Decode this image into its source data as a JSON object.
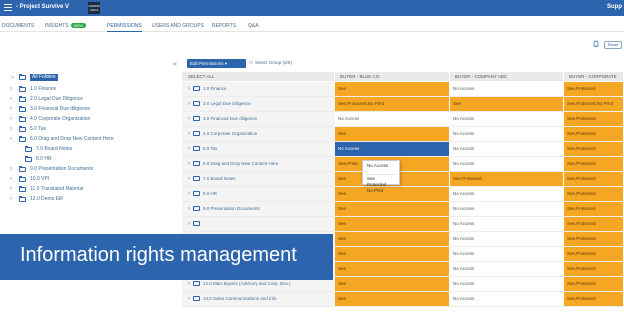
{
  "topbar": {
    "project": "- Project Survive V",
    "logo_line1": "HARRIS",
    "logo_line2": "LINKS",
    "right_label": "Supp"
  },
  "tabs": [
    {
      "label": "DOCUMENTS"
    },
    {
      "label": "INSIGHTS",
      "badge": "NEW"
    },
    {
      "label": "PERMISSIONS"
    },
    {
      "label": "USERS AND GROUPS"
    },
    {
      "label": "REPORTS"
    },
    {
      "label": "Q&A"
    }
  ],
  "actions": {
    "reset_label": "Reset",
    "collapse_glyph": "«"
  },
  "toolbar": {
    "edit_permissions": "Edit Permissions ▾",
    "select_group": "Select Group (2/5)"
  },
  "tree": [
    {
      "label": "All Folders"
    },
    {
      "label": "1.0 Finance"
    },
    {
      "label": "2.0 Legal Due Diligence"
    },
    {
      "label": "3.0 Financial Due diligence"
    },
    {
      "label": "4.0 Corporate Organization"
    },
    {
      "label": "5.0 Tax"
    },
    {
      "label": "6.0 Drag and Drop New Content Here"
    },
    {
      "label": "7.0 Board Notes"
    },
    {
      "label": "8.0 HR"
    },
    {
      "label": "9.0 Presentation Documents"
    },
    {
      "label": "10.0 VPI"
    },
    {
      "label": "11.0 Translated Material"
    },
    {
      "label": "12.0 Demo Elif"
    }
  ],
  "grid": {
    "headers": {
      "select_all": "SELECT ALL",
      "col1": "BUYER - BLUE CO.",
      "col2": "BUYER - COMPANY ABC",
      "col3": "BUYER - CORPORATE"
    },
    "rows": [
      {
        "name": "1.0 Finance",
        "c1": "See",
        "c2": "No Access",
        "c3": "See,Protected"
      },
      {
        "name": "2.0 Legal Due Diligence",
        "c1": "See,Protected,No Print",
        "c2": "See",
        "c3": "See,Protected,No Print"
      },
      {
        "name": "3.0 Financial Due diligence",
        "c1": "No Access",
        "c2": "No Access",
        "c3": "See,Protected"
      },
      {
        "name": "4.0 Corporate Organization",
        "c1": "See",
        "c2": "No Access",
        "c3": "See,Protected"
      },
      {
        "name": "5.0 Tax",
        "c1": "No Access",
        "c2": "No Access",
        "c3": "See,Protected"
      },
      {
        "name": "6.0 Drag and Drop New Content Here",
        "c1": "See,Prote",
        "c2": "No Access",
        "c3": "See,Protected"
      },
      {
        "name": "7.0 Board Notes",
        "c1": "See",
        "c2": "See,Protected",
        "c3": "See,Protected"
      },
      {
        "name": "8.0 HR",
        "c1": "See",
        "c2": "No Access",
        "c3": "See,Protected"
      },
      {
        "name": "9.0 Presentation Documents",
        "c1": "See",
        "c2": "No Access",
        "c3": "See,Protected"
      },
      {
        "name": "",
        "c1": "See",
        "c2": "No Access",
        "c3": "See,Protected"
      },
      {
        "name": "",
        "c1": "See",
        "c2": "No Access",
        "c3": "See,Protected"
      },
      {
        "name": "",
        "c1": "See",
        "c2": "No Access",
        "c3": "See,Protected"
      },
      {
        "name": "",
        "c1": "See",
        "c2": "No Access",
        "c3": "See,Protected"
      },
      {
        "name": "12.0 M&A Buyers (Advisory and Corp. Dev.)",
        "c1": "See",
        "c2": "No Access",
        "c3": "See,Protected"
      },
      {
        "name": "14.0 Sales Communications and Info",
        "c1": "See",
        "c2": "No Access",
        "c3": "See,Protected"
      }
    ]
  },
  "context_menu": {
    "no_access": "No Access",
    "see": "See",
    "protected": "Protected",
    "no_print": "No Print"
  },
  "banner": {
    "text": "Information rights management"
  },
  "colors": {
    "brand_blue": "#2c64ad",
    "see_orange": "#f5a623",
    "header_gray": "#e9e9e9",
    "badge_green": "#28a745"
  },
  "icons": {
    "menu": "hamburger-icon",
    "bell": "bell-icon",
    "folder": "folder-icon",
    "chevron": "chevron-right-icon",
    "people": "people-icon"
  }
}
